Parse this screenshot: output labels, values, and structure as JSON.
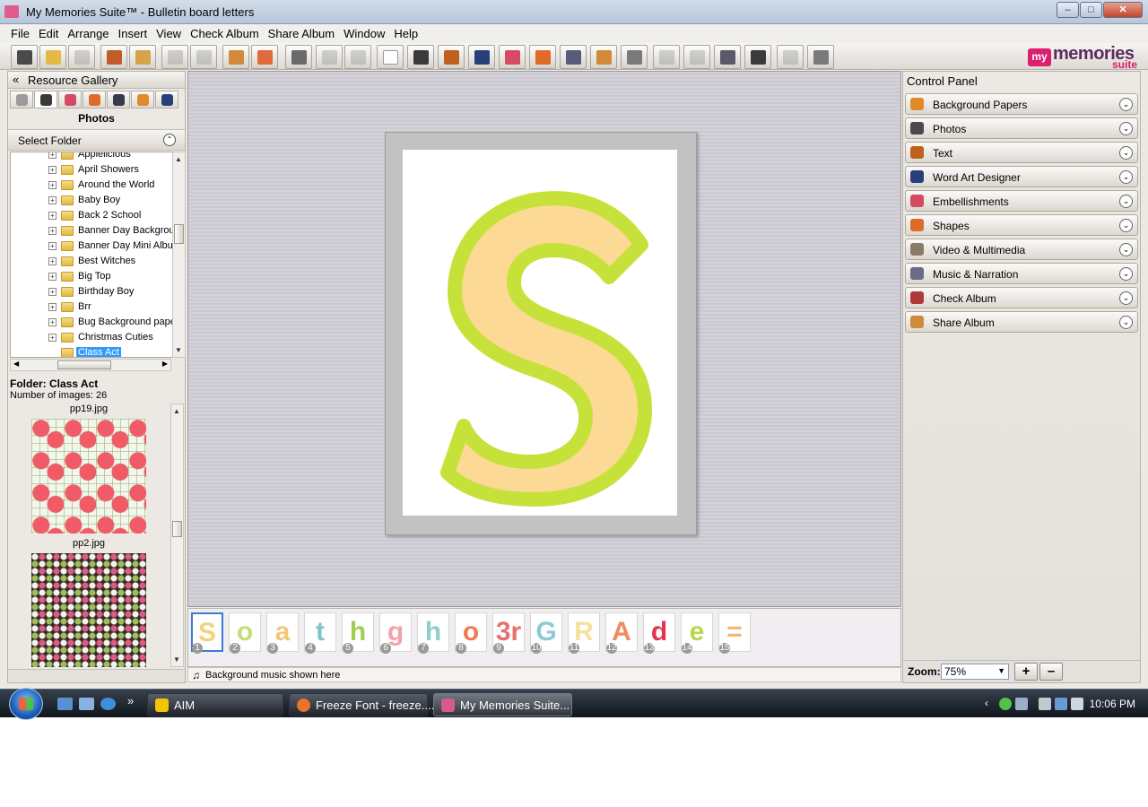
{
  "window": {
    "title": "My Memories Suite™ - Bulletin board letters",
    "controls": [
      "–",
      "□",
      "✕"
    ]
  },
  "menu": [
    "File",
    "Edit",
    "Arrange",
    "Insert",
    "View",
    "Check Album",
    "Share Album",
    "Window",
    "Help"
  ],
  "logo": {
    "my": "my",
    "memories": "memories",
    "suite": "suite"
  },
  "resource_gallery": {
    "header": "Resource Gallery",
    "collapse_glyph": "«",
    "section_title": "Photos",
    "select_folder_label": "Select Folder",
    "folders": [
      "Applelicious",
      "April Showers",
      "Around the World",
      "Baby Boy",
      "Back 2 School",
      "Banner Day Backgrou",
      "Banner Day Mini Albur",
      "Best Witches",
      "Big Top",
      "Birthday Boy",
      "Brr",
      "Bug Background pape",
      "Christmas Cuties",
      "Class Act"
    ],
    "selected_folder": "Class Act",
    "folder_info_name": "Folder: Class Act",
    "folder_info_count": "Number of images: 26",
    "images": [
      {
        "caption": "pp19.jpg"
      },
      {
        "caption": "pp2.jpg"
      }
    ]
  },
  "canvas": {
    "letter": "S",
    "letter_fill": "#fcd994",
    "letter_outline": "#c6e23a"
  },
  "filmstrip": {
    "frames": [
      {
        "num": "1",
        "glyph": "S",
        "color": "#f2d27a"
      },
      {
        "num": "2",
        "glyph": "o",
        "color": "#c7dc7a"
      },
      {
        "num": "3",
        "glyph": "a",
        "color": "#f3c67d"
      },
      {
        "num": "4",
        "glyph": "t",
        "color": "#7ec4c7"
      },
      {
        "num": "5",
        "glyph": "h",
        "color": "#9fcf4f"
      },
      {
        "num": "6",
        "glyph": "g",
        "color": "#f2a2a8"
      },
      {
        "num": "7",
        "glyph": "h",
        "color": "#8fcfc8"
      },
      {
        "num": "8",
        "glyph": "o",
        "color": "#f07a54"
      },
      {
        "num": "9",
        "glyph": "3r",
        "color": "#e7716f"
      },
      {
        "num": "10",
        "glyph": "G",
        "color": "#8fc9d6"
      },
      {
        "num": "11",
        "glyph": "R",
        "color": "#f6e0a0"
      },
      {
        "num": "12",
        "glyph": "A",
        "color": "#f08a61"
      },
      {
        "num": "13",
        "glyph": "d",
        "color": "#e4334f"
      },
      {
        "num": "14",
        "glyph": "e",
        "color": "#b6d94a"
      },
      {
        "num": "15",
        "glyph": "=",
        "color": "#f3b57a"
      }
    ],
    "music_label": "Background music shown here"
  },
  "control_panel": {
    "title": "Control Panel",
    "items": [
      {
        "label": "Background Papers",
        "icon": "background-papers-icon",
        "color": "#e08a2a"
      },
      {
        "label": "Photos",
        "icon": "camera-icon",
        "color": "#4a4a4a"
      },
      {
        "label": "Text",
        "icon": "text-icon",
        "color": "#c0601f"
      },
      {
        "label": "Word Art Designer",
        "icon": "word-art-icon",
        "color": "#2a3f7a"
      },
      {
        "label": "Embellishments",
        "icon": "flower-icon",
        "color": "#d64b63"
      },
      {
        "label": "Shapes",
        "icon": "shapes-icon",
        "color": "#e06a2a"
      },
      {
        "label": "Video & Multimedia",
        "icon": "video-icon",
        "color": "#8a7a6a"
      },
      {
        "label": "Music & Narration",
        "icon": "music-icon",
        "color": "#6a6a8a"
      },
      {
        "label": "Check Album",
        "icon": "check-album-icon",
        "color": "#b03a3a"
      },
      {
        "label": "Share Album",
        "icon": "share-album-icon",
        "color": "#d08a3a"
      }
    ],
    "zoom_label": "Zoom:",
    "zoom_value": "75%",
    "zoom_in": "+",
    "zoom_out": "–"
  },
  "taskbar": {
    "more_glyph": "»",
    "tasks": [
      {
        "label": "AIM",
        "color": "#f5c400"
      },
      {
        "label": "Freeze Font - freeze....",
        "color": "#e7742a"
      },
      {
        "label": "My Memories Suite...",
        "color": "#d95a8a"
      }
    ],
    "tray_chevron": "‹",
    "clock": "10:06 PM"
  }
}
